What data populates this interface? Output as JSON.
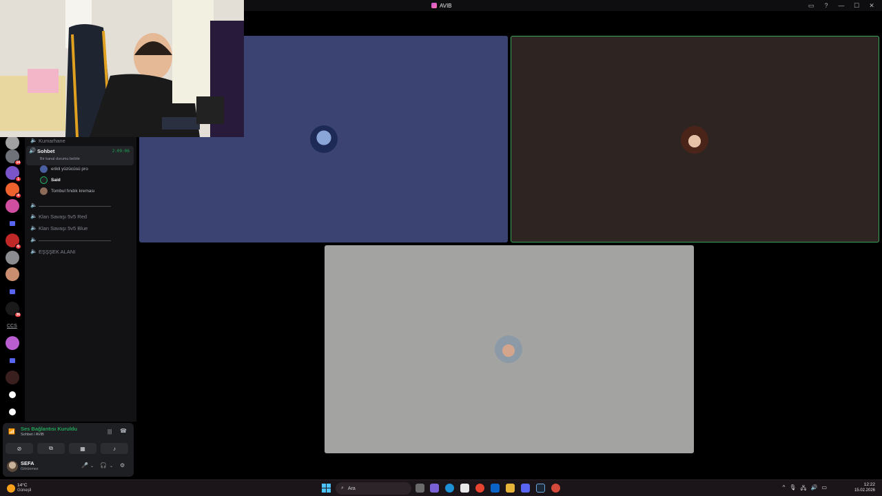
{
  "window": {
    "title": "AVIB"
  },
  "titlebar_icons": [
    "inbox-icon",
    "help-icon",
    "minimize-icon",
    "maximize-icon",
    "close-icon"
  ],
  "titlebar_glyphs": [
    "▭",
    "?",
    "—",
    "☐",
    "✕"
  ],
  "rail": {
    "label": "CCS",
    "servers": [
      {
        "badge": "",
        "color": "#a1a1a1"
      },
      {
        "badge": "14",
        "color": "#6f7379"
      },
      {
        "badge": "1",
        "color": "#7a54c9"
      },
      {
        "badge": "4",
        "color": "#f0622d"
      },
      {
        "badge": "",
        "color": "#d04ea0"
      },
      {
        "badge": "",
        "color": "folder"
      },
      {
        "badge": "6",
        "color": "#c02828"
      },
      {
        "badge": "",
        "color": "#8a8c90"
      },
      {
        "badge": "",
        "color": "#c98d6f"
      },
      {
        "badge": "",
        "color": "folder"
      },
      {
        "badge": "36",
        "color": "#1a1a1a"
      },
      {
        "badge": "",
        "color": "#b85ed0"
      },
      {
        "badge": "",
        "color": "folder"
      },
      {
        "badge": "",
        "color": "#3a1f1f"
      }
    ]
  },
  "channels": {
    "kumarhane": "Kumarhane",
    "active": {
      "name": "Sohbet",
      "timer": "2:09:06",
      "status": "Bir kanal durumu belirle"
    },
    "members": [
      {
        "name": "erikli yüzücüsü pro",
        "color": "#4a5fa0"
      },
      {
        "name": "Said",
        "color": "#23a55a"
      },
      {
        "name": "Tombul fındık kreması",
        "color": "#8b6a58"
      }
    ],
    "separator_1": "——————————————",
    "klan_red": "Klan Savaşı 5v5 Red",
    "klan_blue": "Klan Savaşı 5v5 Blue",
    "separator_2": "——————————————",
    "esssek": "EŞŞŞEK ALANI"
  },
  "voice": {
    "status": "Ses Bağlantısı Kuruldu",
    "sub": "Sohbet  /  AVIB"
  },
  "user": {
    "name": "SEFA",
    "status": "Görünmez"
  },
  "taskbar": {
    "temp": "14°C",
    "weather": "Güneşli",
    "search_placeholder": "Ara",
    "time": "12:22",
    "date": "15.02.2026",
    "apps": [
      {
        "color": "#6b6b6b"
      },
      {
        "color": "#7b61d6"
      },
      {
        "color": "#1e90d6"
      },
      {
        "color": "#e8e8e8"
      },
      {
        "color": "#e8442f"
      },
      {
        "color": "#0a64c8"
      },
      {
        "color": "#e8b339"
      },
      {
        "color": "#5865f2"
      },
      {
        "color": "#1b2838"
      },
      {
        "color": "#d44a3a"
      }
    ]
  }
}
